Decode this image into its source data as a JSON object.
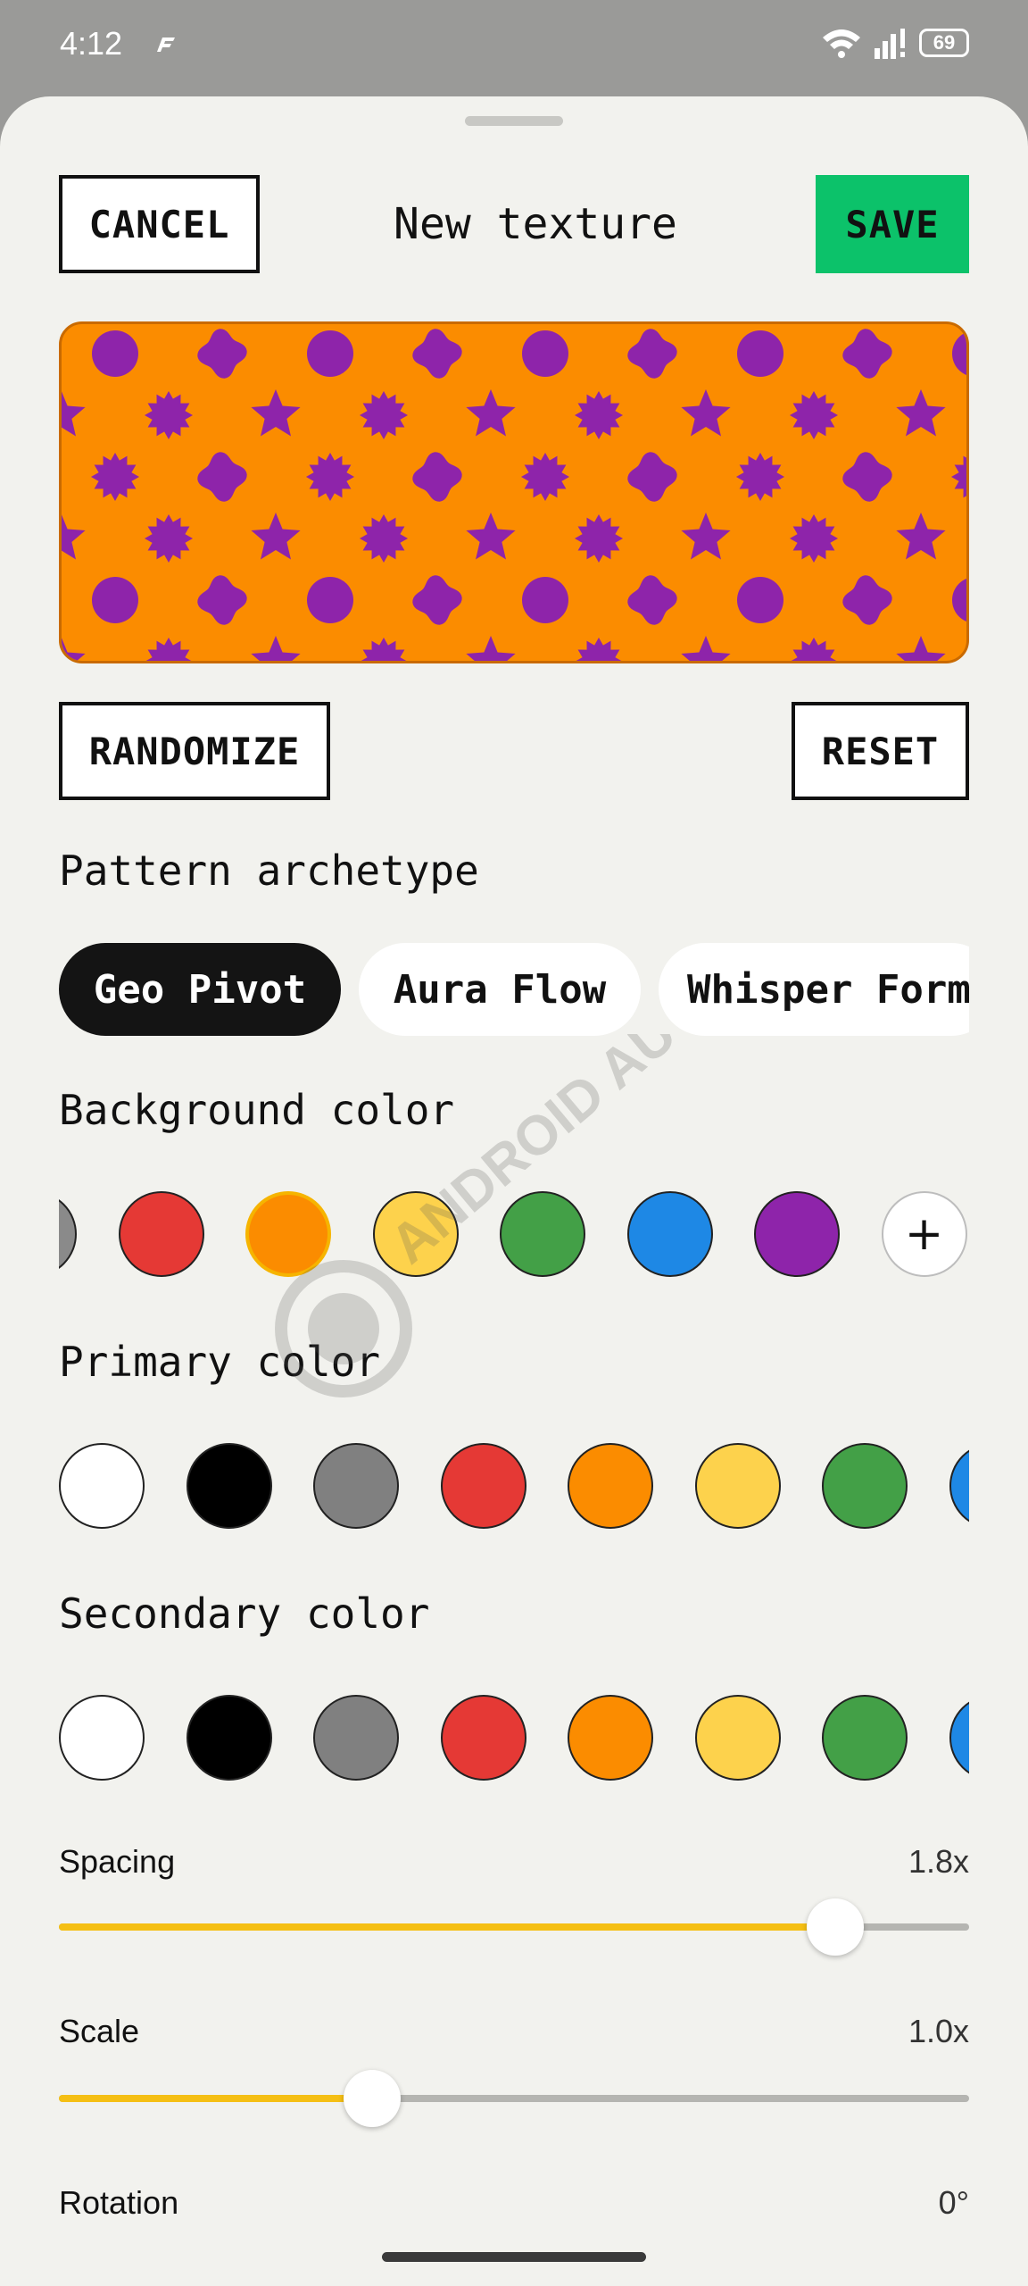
{
  "status_bar": {
    "time": "4:12",
    "battery": "69",
    "icons": [
      "app-f-icon",
      "wifi-icon",
      "signal-icon",
      "battery-icon"
    ]
  },
  "header": {
    "cancel_label": "CANCEL",
    "title": "New texture",
    "save_label": "SAVE",
    "save_color": "#0cc26a"
  },
  "preview": {
    "background_color": "#fb8c00",
    "pattern_color": "#8e24aa",
    "shapes": [
      "circle",
      "blob",
      "starburst",
      "star"
    ]
  },
  "actions": {
    "randomize_label": "RANDOMIZE",
    "reset_label": "RESET"
  },
  "pattern_archetype": {
    "label": "Pattern archetype",
    "options": [
      "Geo Pivot",
      "Aura Flow",
      "Whisper Form"
    ],
    "selected": "Geo Pivot"
  },
  "background_color": {
    "label": "Background color",
    "swatches": [
      "#8a8a8a",
      "#e53935",
      "#fb8c00",
      "#fdd24c",
      "#43a047",
      "#1e88e5",
      "#8e24aa"
    ],
    "selected_index": 2,
    "add_label": "+"
  },
  "primary_color": {
    "label": "Primary color",
    "swatches": [
      "#ffffff",
      "#000000",
      "#808080",
      "#e53935",
      "#fb8c00",
      "#fdd24c",
      "#43a047",
      "#1e88e5"
    ]
  },
  "secondary_color": {
    "label": "Secondary color",
    "swatches": [
      "#ffffff",
      "#000000",
      "#808080",
      "#e53935",
      "#fb8c00",
      "#fdd24c",
      "#43a047",
      "#1e88e5"
    ]
  },
  "sliders": {
    "spacing": {
      "label": "Spacing",
      "value": "1.8x",
      "fraction": 0.853
    },
    "scale": {
      "label": "Scale",
      "value": "1.0x",
      "fraction": 0.344
    },
    "rotation": {
      "label": "Rotation",
      "value": "0°"
    }
  },
  "accent_color": "#f5bf14",
  "watermark": "ANDROID AUTHORITY"
}
